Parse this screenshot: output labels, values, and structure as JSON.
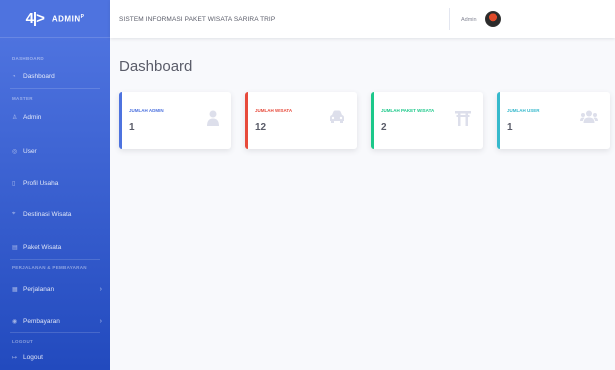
{
  "brand": {
    "logo": "4|>",
    "name": "ADMIN",
    "sup": "P"
  },
  "sidebar": {
    "headings": [
      "DASHBOARD",
      "MASTER",
      "PERJALANAN & PEMBAYARAN",
      "LOGOUT"
    ],
    "items": [
      {
        "label": "Dashboard",
        "icon": "tachometer-icon"
      },
      {
        "label": "Admin",
        "icon": "user-icon"
      },
      {
        "label": "User",
        "icon": "user-circle-icon"
      },
      {
        "label": "Profil Usaha",
        "icon": "document-icon"
      },
      {
        "label": "Destinasi Wisata",
        "icon": "map-pin-icon"
      },
      {
        "label": "Paket Wisata",
        "icon": "package-icon"
      },
      {
        "label": "Perjalanan",
        "icon": "calendar-icon"
      },
      {
        "label": "Pembayaran",
        "icon": "money-icon"
      },
      {
        "label": "Logout",
        "icon": "sign-out-icon"
      }
    ]
  },
  "topbar": {
    "title": "SISTEM INFORMASI PAKET WISATA SARIRA TRIP",
    "user": "Admin"
  },
  "page": {
    "title": "Dashboard"
  },
  "cards": [
    {
      "label": "JUMLAH ADMIN",
      "value": "1",
      "icon": "user-icon",
      "color": "#4e73df"
    },
    {
      "label": "JUMLAH WISATA",
      "value": "12",
      "icon": "car-icon",
      "color": "#e74a3b"
    },
    {
      "label": "JUMLAH PAKET WISATA",
      "value": "2",
      "icon": "torii-gate-icon",
      "color": "#1cc88a"
    },
    {
      "label": "JUMLAH USER",
      "value": "1",
      "icon": "users-icon",
      "color": "#36b9cc"
    }
  ]
}
